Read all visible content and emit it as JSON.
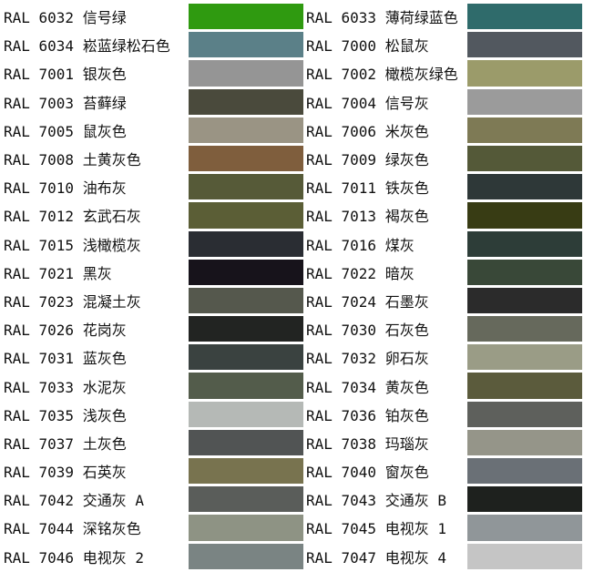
{
  "rows": [
    {
      "left": {
        "label": "RAL 6032 信号绿",
        "color": "#2f9a10"
      },
      "right": {
        "label": "RAL 6033 薄荷绿蓝色",
        "color": "#2f6b6b"
      }
    },
    {
      "left": {
        "label": "RAL 6034 崧蓝绿松石色",
        "color": "#5b8088"
      },
      "right": {
        "label": "RAL 7000 松鼠灰",
        "color": "#52585f"
      }
    },
    {
      "left": {
        "label": "RAL 7001 银灰色",
        "color": "#959595"
      },
      "right": {
        "label": "RAL 7002 橄榄灰绿色",
        "color": "#9b9b6a"
      }
    },
    {
      "left": {
        "label": "RAL 7003 苔藓绿",
        "color": "#4a4a3c"
      },
      "right": {
        "label": "RAL 7004 信号灰",
        "color": "#9b9b9b"
      }
    },
    {
      "left": {
        "label": "RAL 7005 鼠灰色",
        "color": "#9a9484"
      },
      "right": {
        "label": "RAL 7006 米灰色",
        "color": "#7e7a55"
      }
    },
    {
      "left": {
        "label": "RAL 7008 土黄灰色",
        "color": "#7f5e3d"
      },
      "right": {
        "label": "RAL 7009 绿灰色",
        "color": "#545938"
      }
    },
    {
      "left": {
        "label": "RAL 7010 油布灰",
        "color": "#565a38"
      },
      "right": {
        "label": "RAL 7011 铁灰色",
        "color": "#2e3838"
      }
    },
    {
      "left": {
        "label": "RAL 7012 玄武石灰",
        "color": "#5b5e36"
      },
      "right": {
        "label": "RAL 7013 褐灰色",
        "color": "#383c14"
      }
    },
    {
      "left": {
        "label": "RAL 7015 浅橄榄灰",
        "color": "#2a2d33"
      },
      "right": {
        "label": "RAL 7016 煤灰",
        "color": "#2d3d38"
      }
    },
    {
      "left": {
        "label": "RAL 7021 黑灰",
        "color": "#17131b"
      },
      "right": {
        "label": "RAL 7022 暗灰",
        "color": "#394838"
      }
    },
    {
      "left": {
        "label": "RAL 7023 混凝土灰",
        "color": "#55584d"
      },
      "right": {
        "label": "RAL 7024 石墨灰",
        "color": "#2b2b2b"
      }
    },
    {
      "left": {
        "label": "RAL 7026 花岗灰",
        "color": "#222422"
      },
      "right": {
        "label": "RAL 7030 石灰色",
        "color": "#66695c"
      }
    },
    {
      "left": {
        "label": "RAL 7031 蓝灰色",
        "color": "#3a4240"
      },
      "right": {
        "label": "RAL 7032 卵石灰",
        "color": "#9a9c86"
      }
    },
    {
      "left": {
        "label": "RAL 7033 水泥灰",
        "color": "#535c4b"
      },
      "right": {
        "label": "RAL 7034 黄灰色",
        "color": "#5b5b3c"
      }
    },
    {
      "left": {
        "label": "RAL 7035 浅灰色",
        "color": "#b5b9b6"
      },
      "right": {
        "label": "RAL 7036 铂灰色",
        "color": "#5e605c"
      }
    },
    {
      "left": {
        "label": "RAL 7037 土灰色",
        "color": "#515454"
      },
      "right": {
        "label": "RAL 7038 玛瑙灰",
        "color": "#959589"
      }
    },
    {
      "left": {
        "label": "RAL 7039 石英灰",
        "color": "#78734f"
      },
      "right": {
        "label": "RAL 7040 窗灰色",
        "color": "#6a7076"
      }
    },
    {
      "left": {
        "label": "RAL 7042 交通灰 A",
        "color": "#5a5d5a"
      },
      "right": {
        "label": "RAL 7043 交通灰 B",
        "color": "#1e211e"
      }
    },
    {
      "left": {
        "label": "RAL 7044 深铭灰色",
        "color": "#8e9384"
      },
      "right": {
        "label": "RAL 7045 电视灰 1",
        "color": "#909699"
      }
    },
    {
      "left": {
        "label": "RAL 7046 电视灰 2",
        "color": "#7a8483"
      },
      "right": {
        "label": "RAL 7047 电视灰 4",
        "color": "#c5c5c5"
      }
    }
  ]
}
